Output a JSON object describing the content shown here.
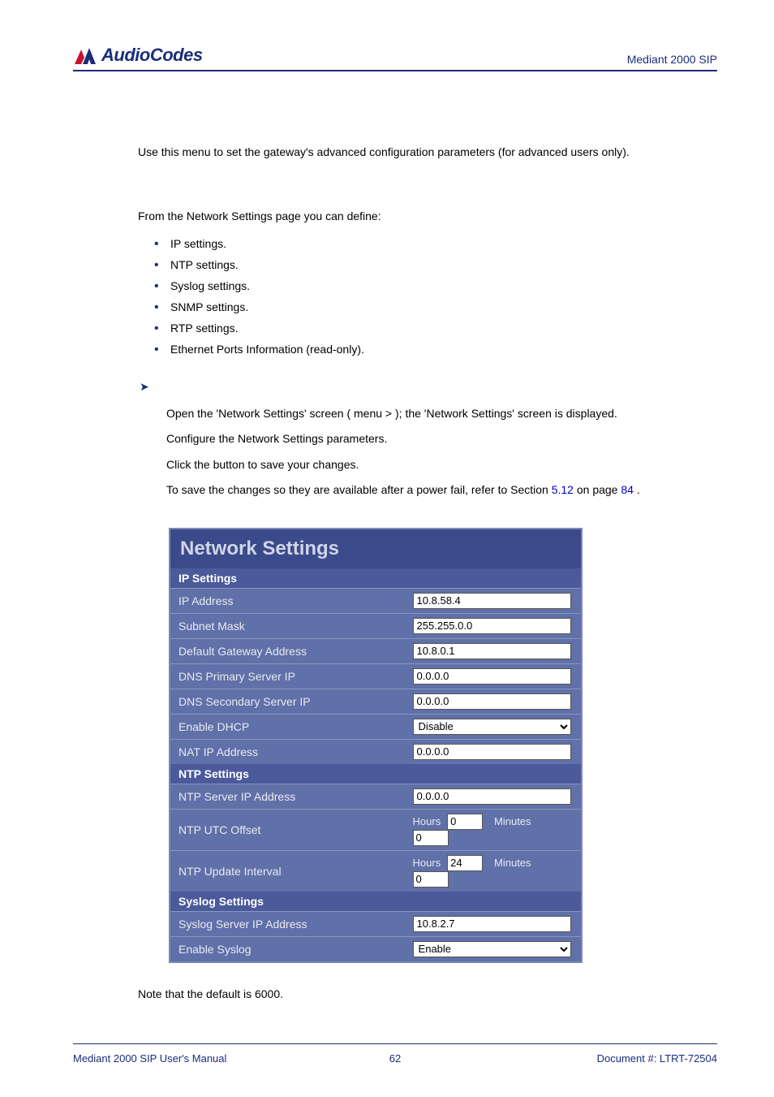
{
  "header": {
    "logo_text": "AudioCodes",
    "product": "Mediant 2000 SIP"
  },
  "body": {
    "intro": "Use this menu to set the gateway's advanced configuration parameters (for advanced users only).",
    "define_line": "From the Network Settings page you can define:",
    "bullets": [
      "IP settings.",
      "NTP settings.",
      "Syslog settings.",
      "SNMP settings.",
      "RTP settings.",
      "Ethernet Ports Information (read-only)."
    ],
    "step1a": "Open the 'Network Settings' screen (",
    "step1b": " menu > ",
    "step1c": "); the 'Network Settings' screen is displayed.",
    "step2": "Configure the Network Settings parameters.",
    "step3a": "Click the ",
    "step3b": " button to save your changes.",
    "step4a": "To save the changes so they are available after a power fail, refer to Section ",
    "step4_link1": "5.12",
    "step4b": " on page ",
    "step4_link2": "84",
    "step4c": ".",
    "note_a": "Note that the default ",
    "note_b": " is 6000."
  },
  "table": {
    "title": "Network Settings",
    "sections": {
      "ip": {
        "header": "IP Settings",
        "rows": {
          "ip_address": {
            "label": "IP Address",
            "value": "10.8.58.4"
          },
          "subnet_mask": {
            "label": "Subnet Mask",
            "value": "255.255.0.0"
          },
          "gateway": {
            "label": "Default Gateway Address",
            "value": "10.8.0.1"
          },
          "dns1": {
            "label": "DNS Primary Server IP",
            "value": "0.0.0.0"
          },
          "dns2": {
            "label": "DNS Secondary Server IP",
            "value": "0.0.0.0"
          },
          "dhcp": {
            "label": "Enable DHCP",
            "value": "Disable"
          },
          "nat": {
            "label": "NAT IP Address",
            "value": "0.0.0.0"
          }
        }
      },
      "ntp": {
        "header": "NTP Settings",
        "rows": {
          "ntp_server": {
            "label": "NTP Server IP Address",
            "value": "0.0.0.0"
          },
          "utc_offset": {
            "label": "NTP UTC Offset",
            "hours_label": "Hours",
            "hours": "0",
            "minutes_label": "Minutes",
            "minutes": "0"
          },
          "update_interval": {
            "label": "NTP Update Interval",
            "hours_label": "Hours",
            "hours": "24",
            "minutes_label": "Minutes",
            "minutes": "0"
          }
        }
      },
      "syslog": {
        "header": "Syslog Settings",
        "rows": {
          "syslog_server": {
            "label": "Syslog Server IP Address",
            "value": "10.8.2.7"
          },
          "enable_syslog": {
            "label": "Enable Syslog",
            "value": "Enable"
          }
        }
      }
    }
  },
  "footer": {
    "left": "Mediant 2000 SIP User's Manual",
    "center": "62",
    "right": "Document #: LTRT-72504"
  }
}
